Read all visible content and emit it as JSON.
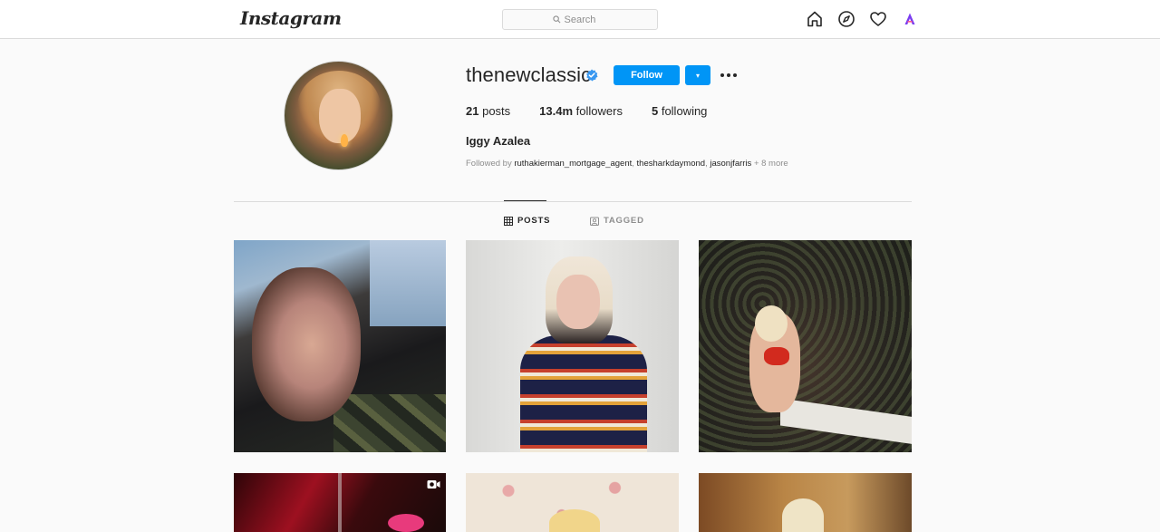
{
  "app": {
    "logo_text": "Instagram"
  },
  "search": {
    "placeholder": "Search"
  },
  "nav": {
    "icons": [
      "home-icon",
      "explore-icon",
      "activity-heart-icon",
      "profile-avatar-icon"
    ]
  },
  "profile": {
    "username": "thenewclassic",
    "verified": true,
    "follow_label": "Follow",
    "dropdown_label": "▾",
    "stats": {
      "posts_count": "21",
      "posts_label": "posts",
      "followers_count": "13.4m",
      "followers_label": "followers",
      "following_count": "5",
      "following_label": "following"
    },
    "full_name": "Iggy Azalea",
    "followed_by": {
      "prefix": "Followed by",
      "accounts": [
        "ruthakierman_mortgage_agent",
        "thesharkdaymond",
        "jasonjfarris"
      ],
      "suffix": "+ 8 more"
    }
  },
  "tabs": [
    {
      "label": "POSTS",
      "active": true,
      "icon": "grid-icon"
    },
    {
      "label": "TAGGED",
      "active": false,
      "icon": "tagged-icon"
    }
  ],
  "posts": [
    {
      "type": "photo"
    },
    {
      "type": "photo"
    },
    {
      "type": "photo"
    },
    {
      "type": "video"
    },
    {
      "type": "photo"
    },
    {
      "type": "photo"
    }
  ],
  "colors": {
    "accent": "#0095f6",
    "border": "#dbdbdb",
    "text": "#262626",
    "muted": "#8e8e8e",
    "background": "#fafafa"
  }
}
